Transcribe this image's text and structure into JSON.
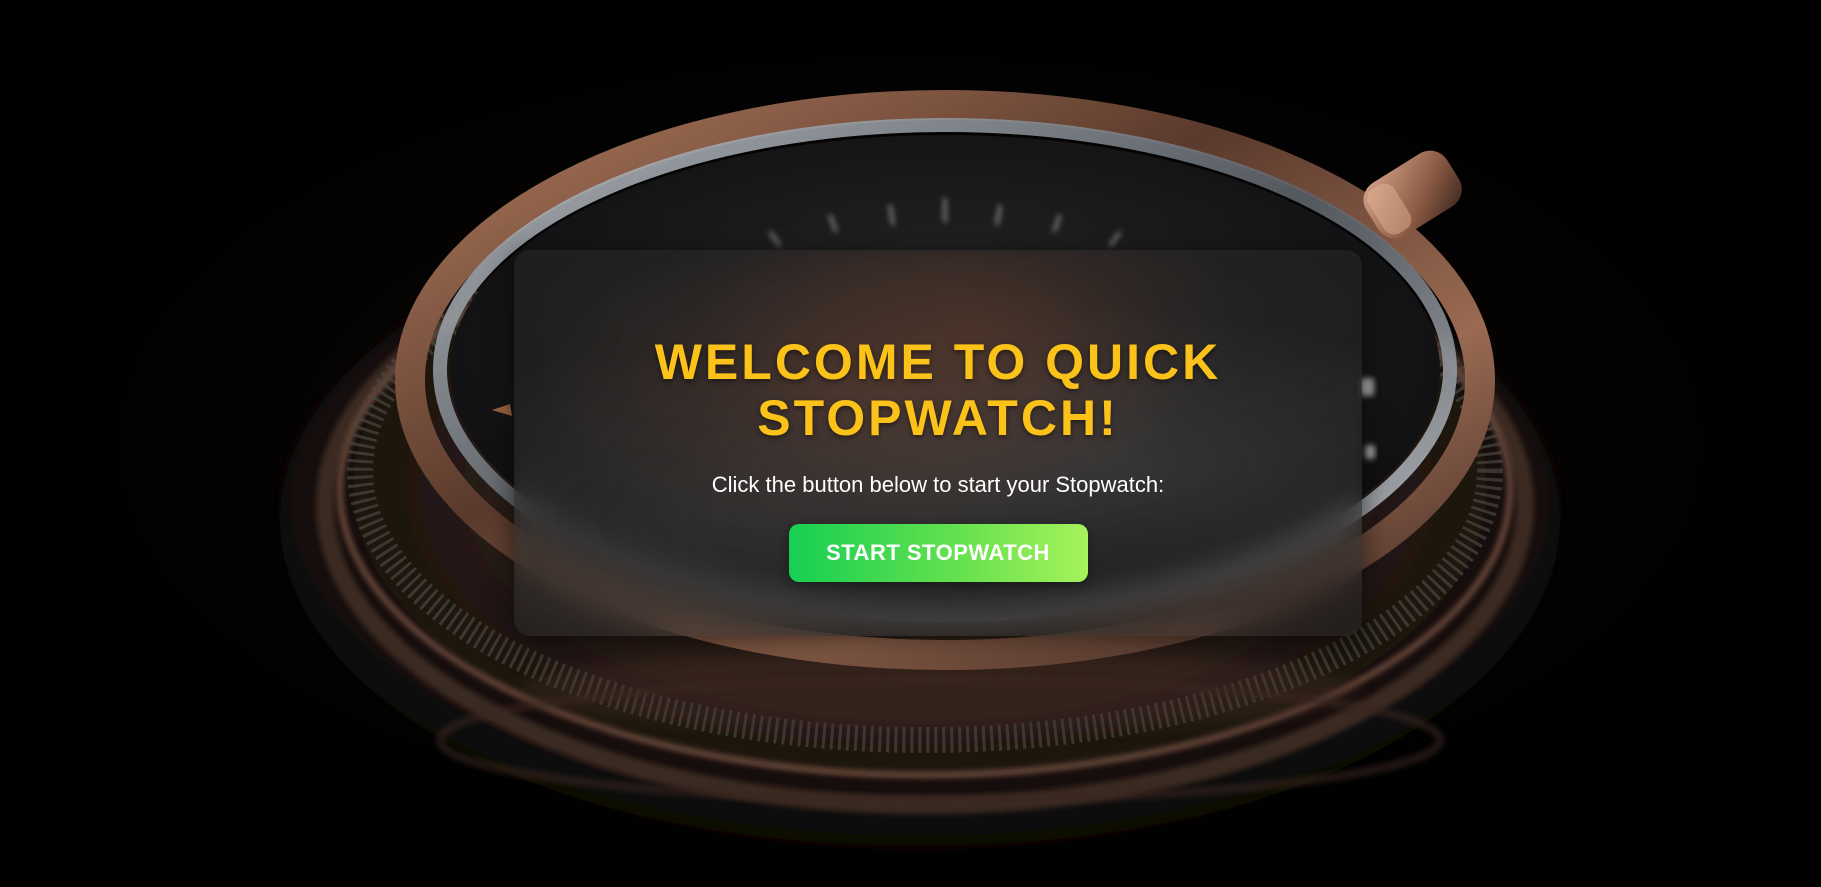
{
  "hero": {
    "title": "WELCOME TO QUICK STOPWATCH!",
    "subtitle": "Click the button below to start your Stopwatch:",
    "start_button_label": "START STOPWATCH"
  },
  "colors": {
    "background": "#000000",
    "title": "#fbc31a",
    "subtitle": "#ffffff",
    "button_gradient_start": "#16cf52",
    "button_gradient_end": "#a6f25b",
    "button_text": "#ffffff"
  },
  "background_image": {
    "icon": "stopwatch-icon"
  }
}
